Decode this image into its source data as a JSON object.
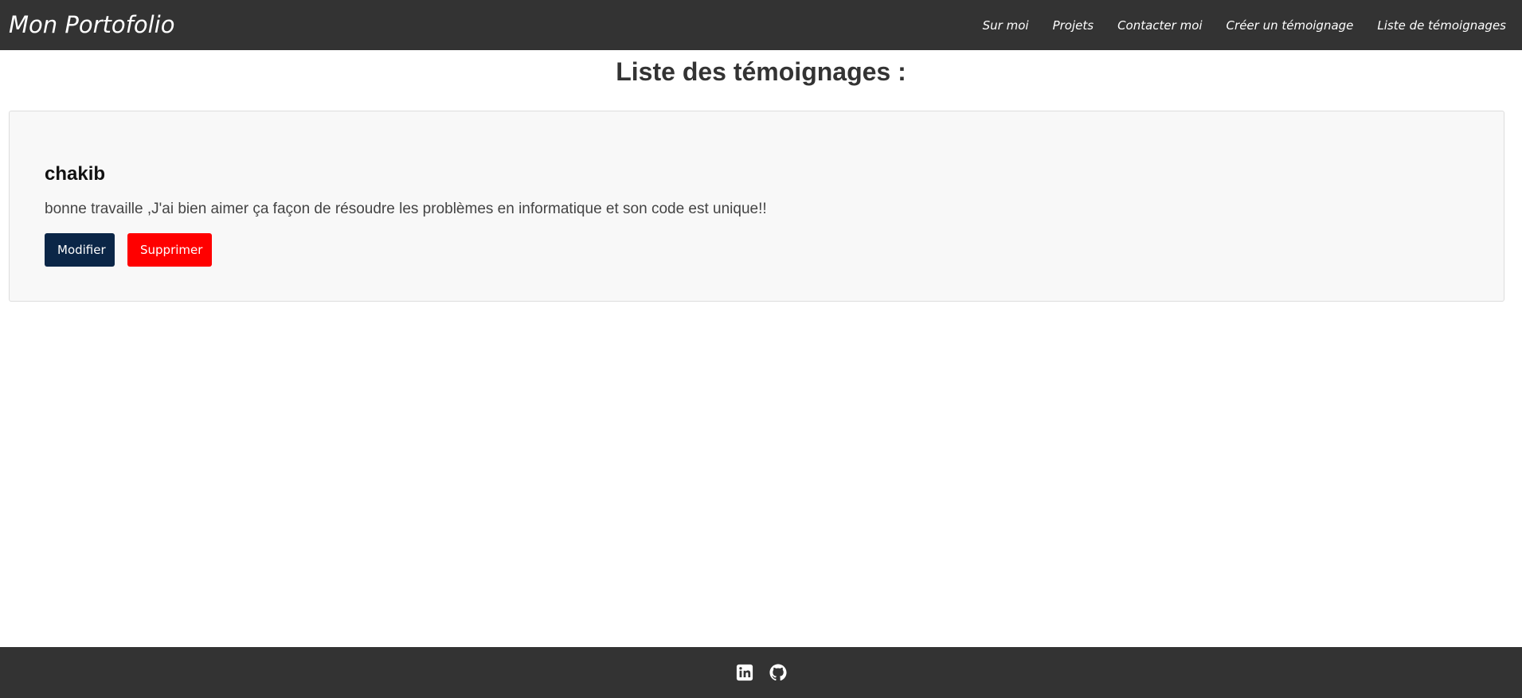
{
  "navbar": {
    "brand": "Mon Portofolio",
    "links": [
      {
        "label": "Sur moi"
      },
      {
        "label": "Projets"
      },
      {
        "label": "Contacter moi"
      },
      {
        "label": "Créer un témoignage"
      },
      {
        "label": "Liste de témoignages"
      }
    ]
  },
  "main": {
    "title": "Liste des témoignages :",
    "testimonials": [
      {
        "name": "chakib",
        "text": "bonne travaille ,J'ai bien aimer ça façon de résoudre les problèmes en informatique et son code est unique!!",
        "edit_label": "Modifier",
        "delete_label": "Supprimer"
      }
    ]
  },
  "footer": {
    "icons": [
      "linkedin-icon",
      "github-icon"
    ]
  },
  "colors": {
    "navbar_bg": "#333333",
    "edit_button": "#0b2647",
    "delete_button": "#ff0000",
    "card_bg": "#f8f8f8"
  }
}
